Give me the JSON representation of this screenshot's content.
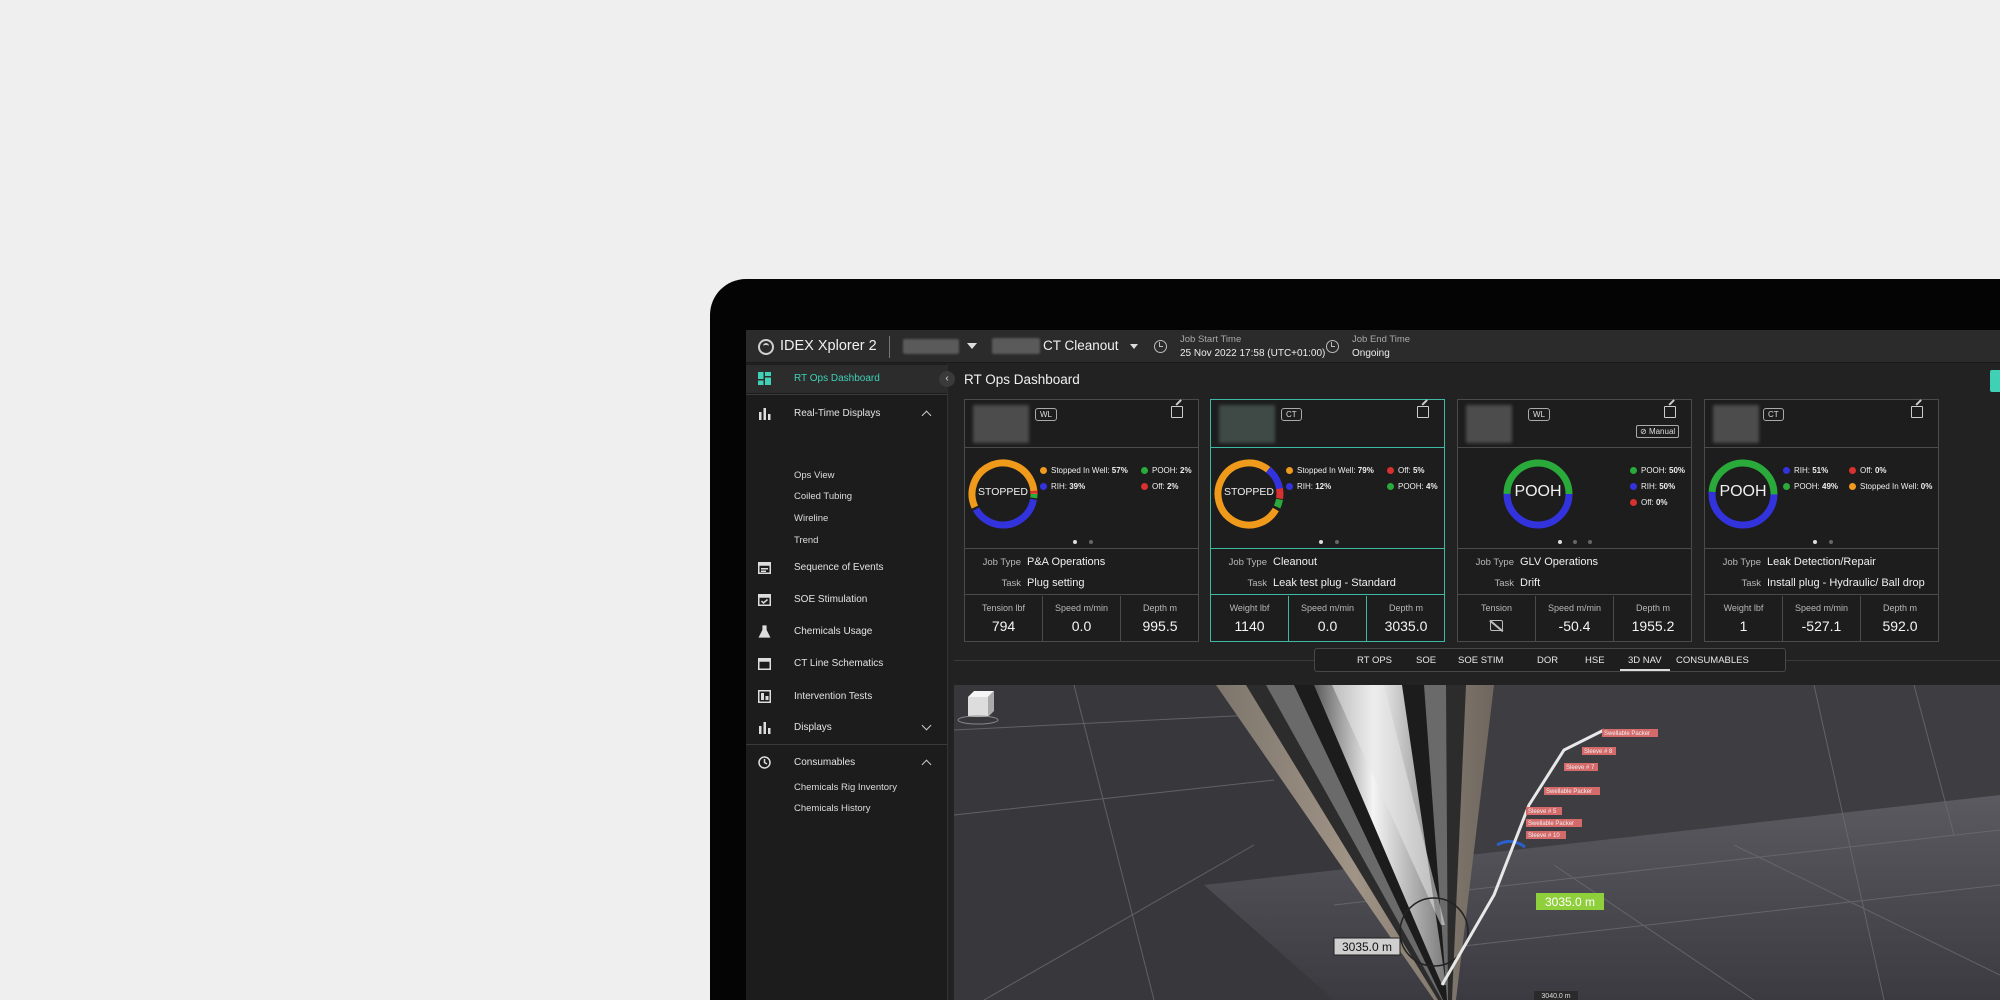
{
  "topbar": {
    "app_title": "IDEX Xplorer 2",
    "job_name": "CT Cleanout",
    "job_start_label": "Job Start Time",
    "job_start_value": "25 Nov 2022 17:58 (UTC+01:00)",
    "job_end_label": "Job End Time",
    "job_end_value": "Ongoing"
  },
  "sidebar": {
    "items": [
      {
        "label": "RT Ops Dashboard",
        "icon": "dashboard-icon",
        "active": true
      },
      {
        "label": "Real-Time Displays",
        "icon": "bar-chart-icon",
        "expanded": true
      },
      {
        "label": "Sequence of Events",
        "icon": "calendar-icon"
      },
      {
        "label": "SOE Stimulation",
        "icon": "calendar-check-icon"
      },
      {
        "label": "Chemicals Usage",
        "icon": "flask-icon"
      },
      {
        "label": "CT Line Schematics",
        "icon": "calendar-icon"
      },
      {
        "label": "Intervention Tests",
        "icon": "report-icon"
      },
      {
        "label": "Displays",
        "icon": "bar-chart-icon",
        "expanded": false
      },
      {
        "label": "Consumables",
        "icon": "history-icon",
        "expanded": true
      }
    ],
    "realtime_sub": [
      "Ops View",
      "Coiled Tubing",
      "Wireline",
      "Trend"
    ],
    "consumables_sub": [
      "Chemicals Rig Inventory",
      "Chemicals History"
    ]
  },
  "main": {
    "page_title": "RT Ops Dashboard"
  },
  "colors": {
    "accent": "#3fd0b6",
    "stopped": "#f09a1c",
    "rih": "#3333dd",
    "pooh": "#2aaa3a",
    "off": "#d93030"
  },
  "cards": [
    {
      "badge": "WL",
      "state": "STOPPED",
      "legend": [
        {
          "label": "Stopped In Well:",
          "value": "57%",
          "color": "#f09a1c"
        },
        {
          "label": "POOH:",
          "value": "2%",
          "color": "#2aaa3a"
        },
        {
          "label": "RIH:",
          "value": "39%",
          "color": "#3333dd"
        },
        {
          "label": "Off:",
          "value": "2%",
          "color": "#d93030"
        }
      ],
      "job_type_label": "Job Type",
      "job_type": "P&A Operations",
      "task_label": "Task",
      "task": "Plug setting",
      "metrics": [
        {
          "label": "Tension lbf",
          "value": "794"
        },
        {
          "label": "Speed m/min",
          "value": "0.0"
        },
        {
          "label": "Depth m",
          "value": "995.5"
        }
      ]
    },
    {
      "badge": "CT",
      "state": "STOPPED",
      "legend": [
        {
          "label": "Stopped In Well:",
          "value": "79%",
          "color": "#f09a1c"
        },
        {
          "label": "Off:",
          "value": "5%",
          "color": "#d93030"
        },
        {
          "label": "RIH:",
          "value": "12%",
          "color": "#3333dd"
        },
        {
          "label": "POOH:",
          "value": "4%",
          "color": "#2aaa3a"
        }
      ],
      "job_type_label": "Job Type",
      "job_type": "Cleanout",
      "task_label": "Task",
      "task": "Leak test plug - Standard",
      "metrics": [
        {
          "label": "Weight lbf",
          "value": "1140"
        },
        {
          "label": "Speed m/min",
          "value": "0.0"
        },
        {
          "label": "Depth m",
          "value": "3035.0"
        }
      ]
    },
    {
      "badge": "WL",
      "manual": "Manual",
      "state": "POOH",
      "legend": [
        {
          "label": "POOH:",
          "value": "50%",
          "color": "#2aaa3a"
        },
        {
          "label": "RIH:",
          "value": "50%",
          "color": "#3333dd"
        },
        {
          "label": "Off:",
          "value": "0%",
          "color": "#d93030"
        }
      ],
      "job_type_label": "Job Type",
      "job_type": "GLV Operations",
      "task_label": "Task",
      "task": "Drift",
      "metrics": [
        {
          "label": "Tension",
          "value": ""
        },
        {
          "label": "Speed m/min",
          "value": "-50.4"
        },
        {
          "label": "Depth m",
          "value": "1955.2"
        }
      ]
    },
    {
      "badge": "CT",
      "state": "POOH",
      "legend": [
        {
          "label": "RIH:",
          "value": "51%",
          "color": "#3333dd"
        },
        {
          "label": "Off:",
          "value": "0%",
          "color": "#d93030"
        },
        {
          "label": "POOH:",
          "value": "49%",
          "color": "#2aaa3a"
        },
        {
          "label": "Stopped In Well:",
          "value": "0%",
          "color": "#f09a1c"
        }
      ],
      "job_type_label": "Job Type",
      "job_type": "Leak Detection/Repair",
      "task_label": "Task",
      "task": "Install plug - Hydraulic/ Ball drop",
      "metrics": [
        {
          "label": "Weight lbf",
          "value": "1"
        },
        {
          "label": "Speed m/min",
          "value": "-527.1"
        },
        {
          "label": "Depth m",
          "value": "592.0"
        }
      ]
    }
  ],
  "tabs": [
    "RT OPS",
    "SOE",
    "SOE STIM",
    "DOR",
    "HSE",
    "3D NAV",
    "CONSUMABLES"
  ],
  "active_tab": "3D NAV",
  "viewport": {
    "depth_tag_main": "3035.0 m",
    "depth_tag_left": "3035.0 m",
    "depth_small": "3040.0 m",
    "completion_labels": [
      "Swellable Packer",
      "Sleeve # 8",
      "Sleeve # 7",
      "Swellable Packer",
      "Sleeve # 5",
      "Swellable Packer",
      "Sleeve # 10"
    ]
  }
}
